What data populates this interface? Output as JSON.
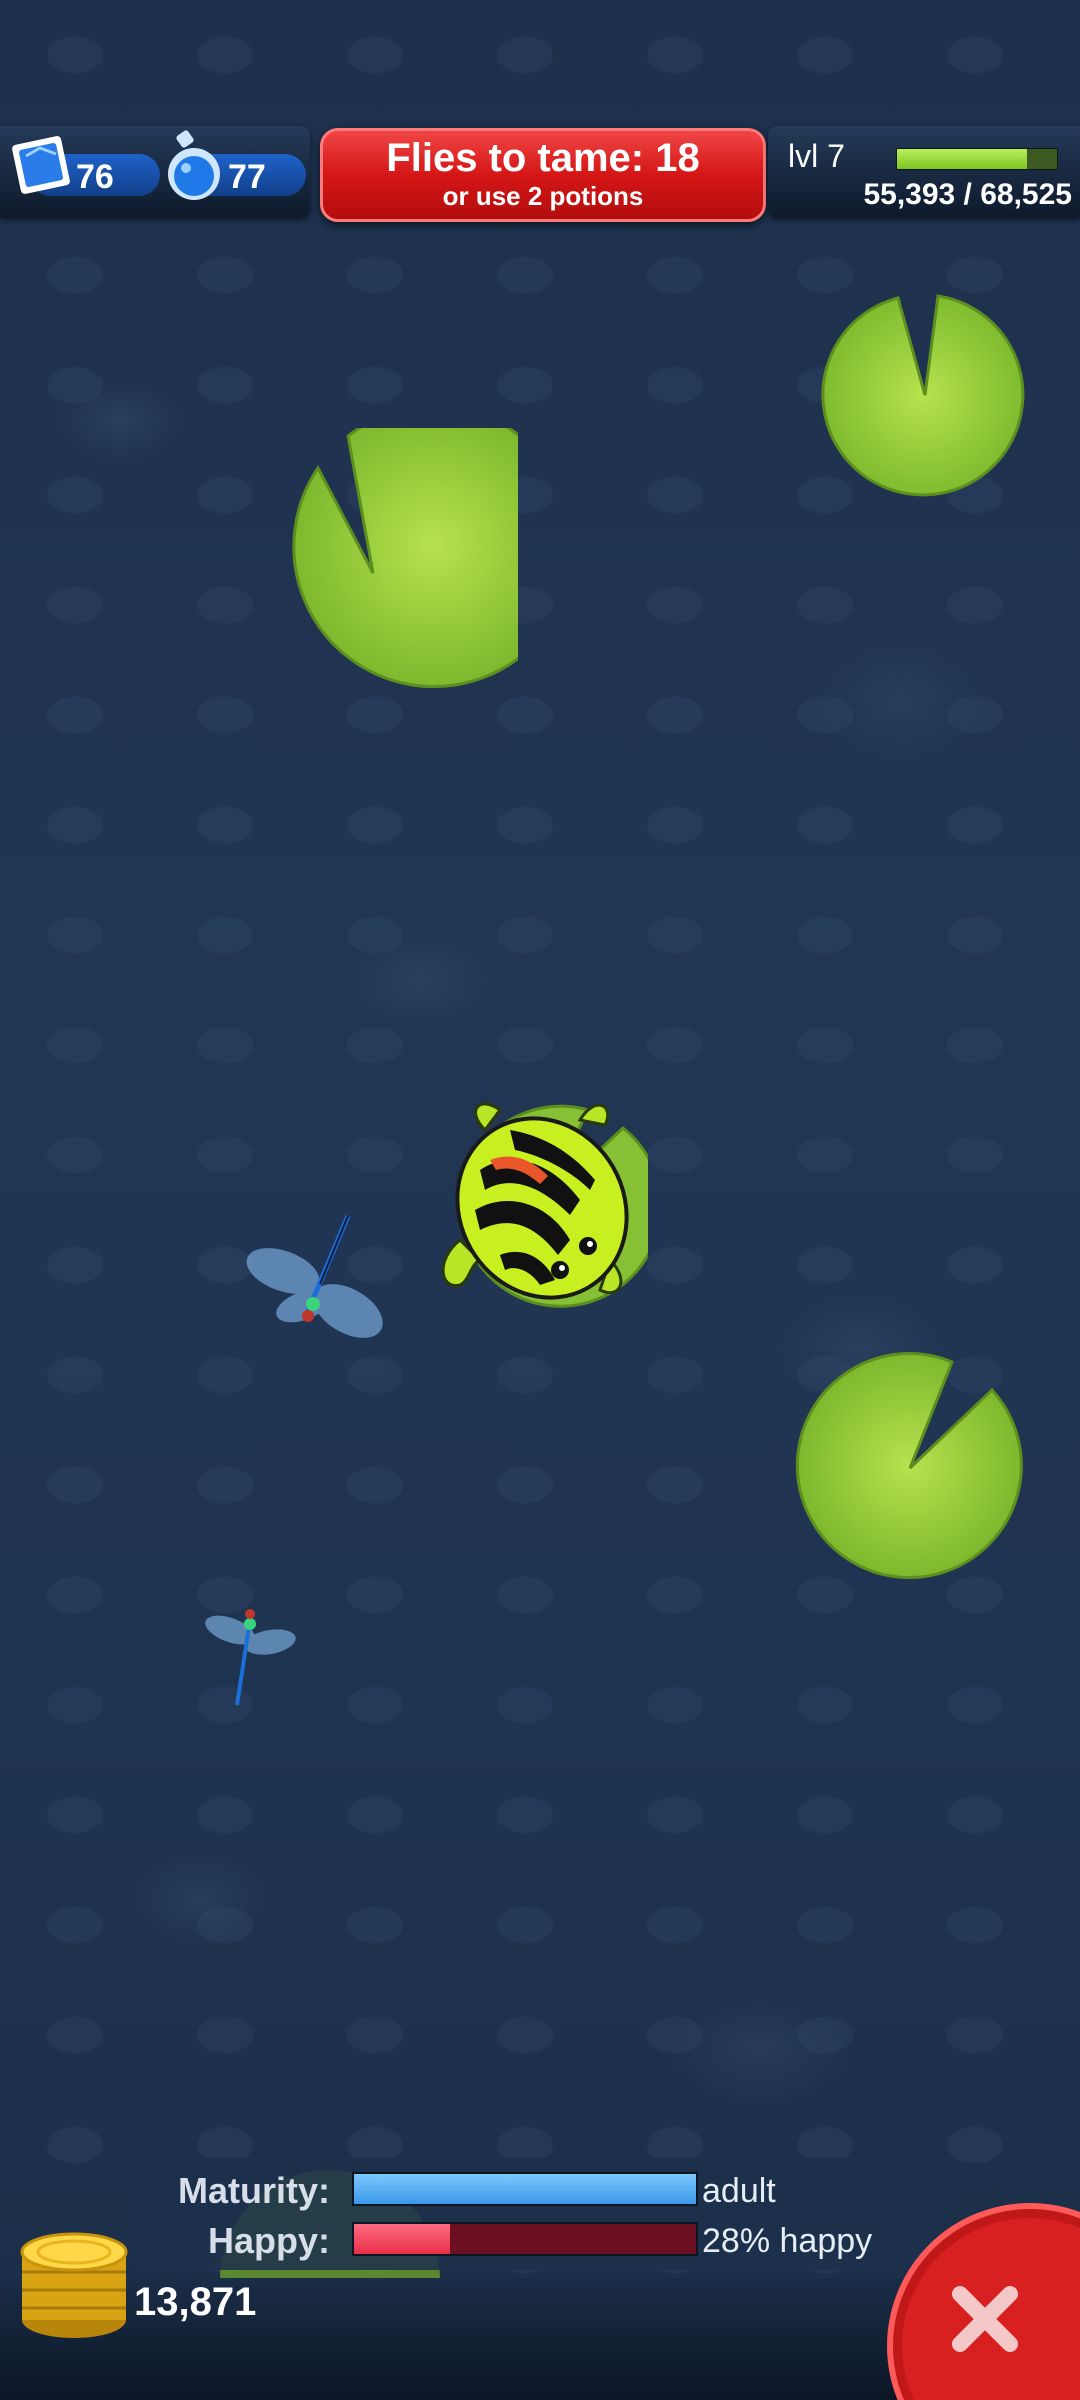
{
  "hud": {
    "gems": "76",
    "potions": "77",
    "tame_title": "Flies to tame: 18",
    "tame_subtitle": "or use 2 potions",
    "level_label": "lvl 7",
    "xp_text": "55,393 / 68,525",
    "xp_fraction": 0.81
  },
  "stats": {
    "maturity_label": "Maturity:",
    "maturity_value": "adult",
    "maturity_fraction": 1.0,
    "happy_label": "Happy:",
    "happy_value": "28% happy",
    "happy_fraction": 0.28
  },
  "coins": "13,871",
  "colors": {
    "banner_red": "#d51616",
    "lilypad_green": "#8cc63a",
    "maturity_blue": "#4fb0ff",
    "happy_red": "#e8304a",
    "frog_yellow": "#c8f020"
  },
  "icons": {
    "gem": "blue-gem-stamp-icon",
    "potion": "blue-potion-icon",
    "coin": "gold-coin-stack-icon",
    "close": "close-x-icon"
  }
}
